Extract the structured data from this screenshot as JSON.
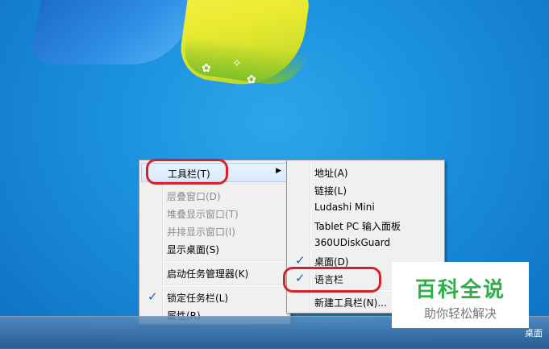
{
  "desktop": {
    "background_color": "#1a8fdc"
  },
  "main_menu": {
    "items": [
      {
        "label": "工具栏(T)",
        "state": "highlighted",
        "has_submenu": true
      },
      {
        "label": "层叠窗口(D)",
        "state": "disabled"
      },
      {
        "label": "堆叠显示窗口(T)",
        "state": "disabled"
      },
      {
        "label": "并排显示窗口(I)",
        "state": "disabled"
      },
      {
        "label": "显示桌面(S)",
        "state": "enabled"
      },
      {
        "label": "启动任务管理器(K)",
        "state": "enabled"
      },
      {
        "label": "锁定任务栏(L)",
        "state": "enabled",
        "checked": true
      },
      {
        "label": "属性(R)",
        "state": "enabled"
      }
    ]
  },
  "sub_menu": {
    "items": [
      {
        "label": "地址(A)"
      },
      {
        "label": "链接(L)"
      },
      {
        "label": "Ludashi Mini"
      },
      {
        "label": "Tablet PC 输入面板"
      },
      {
        "label": "360UDiskGuard"
      },
      {
        "label": "桌面(D)",
        "checked": true
      },
      {
        "label": "语言栏",
        "checked": true
      },
      {
        "label": "新建工具栏(N)..."
      }
    ]
  },
  "icons": {
    "check": "✓",
    "submenu_arrow": "▶"
  },
  "taskbar": {
    "label": "桌面"
  },
  "watermark": {
    "title": "百科全说",
    "subtitle": "助你轻松解决",
    "color": "#2fae4a"
  },
  "annotation_color": "#d6222a"
}
